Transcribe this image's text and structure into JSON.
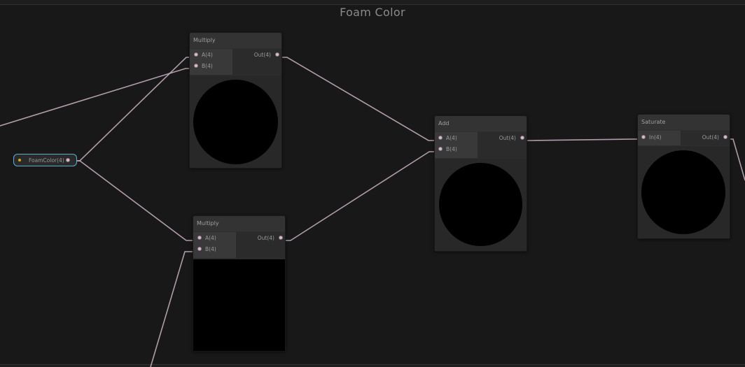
{
  "group": {
    "title": "Foam Color"
  },
  "property": {
    "label": "FoamColor(4)"
  },
  "nodes": {
    "multiply_top": {
      "title": "Multiply",
      "inputs": [
        "A(4)",
        "B(4)"
      ],
      "output": "Out(4)",
      "preview": "circle"
    },
    "multiply_bottom": {
      "title": "Multiply",
      "inputs": [
        "A(4)",
        "B(4)"
      ],
      "output": "Out(4)",
      "preview": "square"
    },
    "add": {
      "title": "Add",
      "inputs": [
        "A(4)",
        "B(4)"
      ],
      "output": "Out(4)",
      "preview": "circle"
    },
    "saturate": {
      "title": "Saturate",
      "inputs": [
        "In(4)"
      ],
      "output": "Out(4)",
      "preview": "circle"
    }
  },
  "colors": {
    "wire": "#cbb4c6",
    "port": "#d8bccd",
    "property_border": "#5ab0d0",
    "property_dot": "#d4a51f"
  }
}
